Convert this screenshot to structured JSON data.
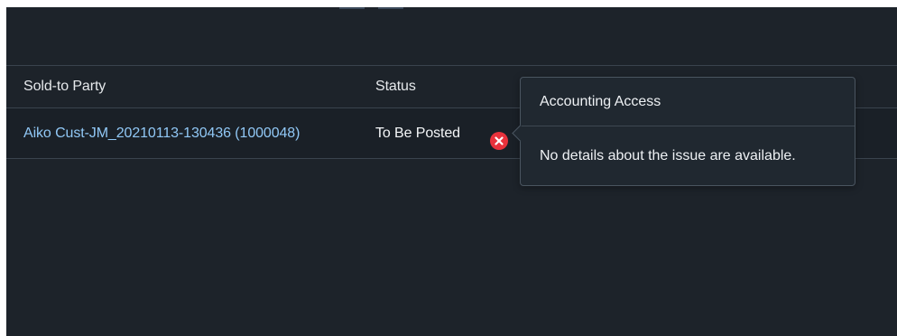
{
  "table": {
    "columns": {
      "sold_to_party": "Sold-to Party",
      "status": "Status"
    },
    "rows": [
      {
        "sold_to_party": "Aiko Cust-JM_20210113-130436 (1000048)",
        "status": "To Be Posted",
        "status_icon": "error-icon"
      }
    ]
  },
  "popover": {
    "title": "Accounting Access",
    "message": "No details about the issue are available."
  },
  "colors": {
    "background": "#1d232a",
    "link": "#91c8f6",
    "error": "#e8323c"
  }
}
